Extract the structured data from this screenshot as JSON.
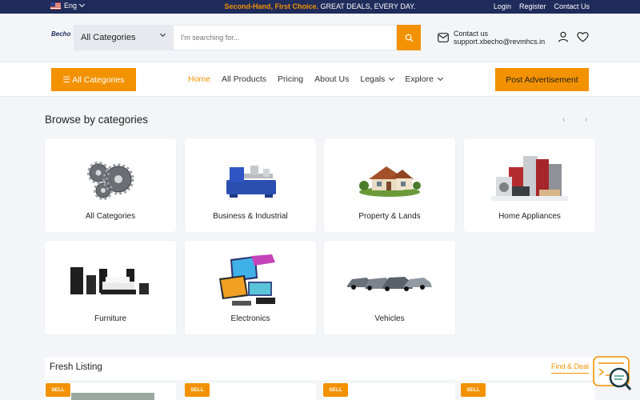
{
  "topbar": {
    "language": "Eng",
    "promo_highlight": "Second-Hand, First Choice.",
    "promo_text": " GREAT DEALS, EVERY DAY.",
    "links": [
      "Login",
      "Register",
      "Contact Us"
    ]
  },
  "header": {
    "logo_text": "Becho",
    "category_select": "All Categories",
    "search_placeholder": "I'm searching for...",
    "contact_label": "Contact us",
    "contact_email": "support.xbecho@revmhcs.in"
  },
  "nav": {
    "all_categories_button": "☰ All Categories",
    "menu": [
      {
        "label": "Home",
        "active": true
      },
      {
        "label": "All Products"
      },
      {
        "label": "Pricing"
      },
      {
        "label": "About Us"
      },
      {
        "label": "Legals",
        "dropdown": true
      },
      {
        "label": "Explore",
        "dropdown": true
      }
    ],
    "post_button": "Post Advertisement"
  },
  "browse": {
    "title": "Browse by categories",
    "prev_arrow": "‹",
    "next_arrow": "›",
    "categories": [
      {
        "label": "All Categories",
        "icon": "gears-icon"
      },
      {
        "label": "Business & Industrial",
        "icon": "lathe-machine-icon"
      },
      {
        "label": "Property & Lands",
        "icon": "house-icon"
      },
      {
        "label": "Home Appliances",
        "icon": "appliances-icon"
      },
      {
        "label": "Furniture",
        "icon": "bedroom-furniture-icon"
      },
      {
        "label": "Electronics",
        "icon": "electronics-icon"
      },
      {
        "label": "Vehicles",
        "icon": "cars-icon"
      }
    ]
  },
  "fresh": {
    "title": "Fresh Listing",
    "find_deal": "Find & Deal",
    "badge": "SELL"
  },
  "colors": {
    "accent": "#f39200",
    "topbar_bg": "#1f2b5b",
    "page_bg": "#f3f5f9"
  }
}
